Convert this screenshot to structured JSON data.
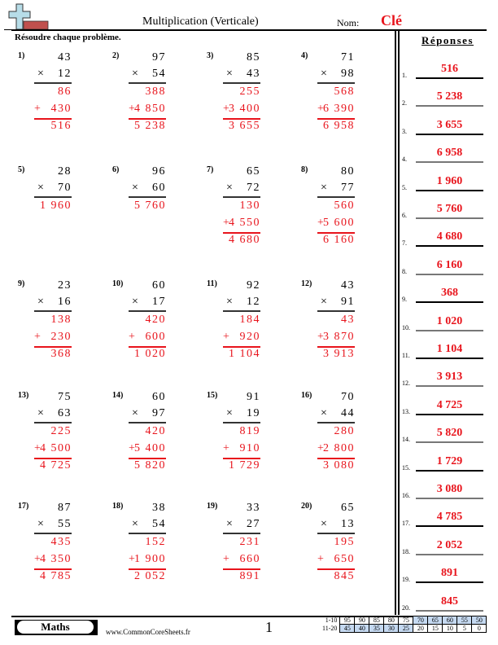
{
  "header": {
    "title": "Multiplication (Verticale)",
    "nom_label": "Nom:",
    "nom_value": "Clé",
    "instructions": "Résoudre chaque problème.",
    "logo_icon": "plus-sign-logo-icon"
  },
  "problems": [
    {
      "num": "1)",
      "a": "43",
      "b": "12",
      "p1": "86",
      "p2": "430",
      "total": "516"
    },
    {
      "num": "2)",
      "a": "97",
      "b": "54",
      "p1": "388",
      "p2": "4 850",
      "total": "5 238"
    },
    {
      "num": "3)",
      "a": "85",
      "b": "43",
      "p1": "255",
      "p2": "3 400",
      "total": "3 655"
    },
    {
      "num": "4)",
      "a": "71",
      "b": "98",
      "p1": "568",
      "p2": "6 390",
      "total": "6 958"
    },
    {
      "num": "5)",
      "a": "28",
      "b": "70",
      "total": "1 960"
    },
    {
      "num": "6)",
      "a": "96",
      "b": "60",
      "total": "5 760"
    },
    {
      "num": "7)",
      "a": "65",
      "b": "72",
      "p1": "130",
      "p2": "4 550",
      "total": "4 680"
    },
    {
      "num": "8)",
      "a": "80",
      "b": "77",
      "p1": "560",
      "p2": "5 600",
      "total": "6 160"
    },
    {
      "num": "9)",
      "a": "23",
      "b": "16",
      "p1": "138",
      "p2": "230",
      "total": "368"
    },
    {
      "num": "10)",
      "a": "60",
      "b": "17",
      "p1": "420",
      "p2": "600",
      "total": "1 020"
    },
    {
      "num": "11)",
      "a": "92",
      "b": "12",
      "p1": "184",
      "p2": "920",
      "total": "1 104"
    },
    {
      "num": "12)",
      "a": "43",
      "b": "91",
      "p1": "43",
      "p2": "3 870",
      "total": "3 913"
    },
    {
      "num": "13)",
      "a": "75",
      "b": "63",
      "p1": "225",
      "p2": "4 500",
      "total": "4 725"
    },
    {
      "num": "14)",
      "a": "60",
      "b": "97",
      "p1": "420",
      "p2": "5 400",
      "total": "5 820"
    },
    {
      "num": "15)",
      "a": "91",
      "b": "19",
      "p1": "819",
      "p2": "910",
      "total": "1 729"
    },
    {
      "num": "16)",
      "a": "70",
      "b": "44",
      "p1": "280",
      "p2": "2 800",
      "total": "3 080"
    },
    {
      "num": "17)",
      "a": "87",
      "b": "55",
      "p1": "435",
      "p2": "4 350",
      "total": "4 785"
    },
    {
      "num": "18)",
      "a": "38",
      "b": "54",
      "p1": "152",
      "p2": "1 900",
      "total": "2 052"
    },
    {
      "num": "19)",
      "a": "33",
      "b": "27",
      "p1": "231",
      "p2": "660",
      "total": "891"
    },
    {
      "num": "20)",
      "a": "65",
      "b": "13",
      "p1": "195",
      "p2": "650",
      "total": "845"
    }
  ],
  "symbols": {
    "times": "×",
    "plus": "+"
  },
  "answers": {
    "title": "Réponses",
    "items": [
      {
        "label": "1.",
        "value": "516"
      },
      {
        "label": "2.",
        "value": "5 238"
      },
      {
        "label": "3.",
        "value": "3 655"
      },
      {
        "label": "4.",
        "value": "6 958"
      },
      {
        "label": "5.",
        "value": "1 960"
      },
      {
        "label": "6.",
        "value": "5 760"
      },
      {
        "label": "7.",
        "value": "4 680"
      },
      {
        "label": "8.",
        "value": "6 160"
      },
      {
        "label": "9.",
        "value": "368"
      },
      {
        "label": "10.",
        "value": "1 020"
      },
      {
        "label": "11.",
        "value": "1 104"
      },
      {
        "label": "12.",
        "value": "3 913"
      },
      {
        "label": "13.",
        "value": "4 725"
      },
      {
        "label": "14.",
        "value": "5 820"
      },
      {
        "label": "15.",
        "value": "1 729"
      },
      {
        "label": "16.",
        "value": "3 080"
      },
      {
        "label": "17.",
        "value": "4 785"
      },
      {
        "label": "18.",
        "value": "2 052"
      },
      {
        "label": "19.",
        "value": "891"
      },
      {
        "label": "20.",
        "value": "845"
      }
    ]
  },
  "footer": {
    "subject": "Maths",
    "website": "www.CommonCoreSheets.fr",
    "page": "1",
    "score_table": {
      "rows": [
        {
          "label": "1-10",
          "scores": [
            "95",
            "90",
            "85",
            "80",
            "75",
            "70",
            "65",
            "60",
            "55",
            "50"
          ],
          "highlight": [
            false,
            false,
            false,
            false,
            false,
            true,
            true,
            true,
            true,
            true
          ]
        },
        {
          "label": "11-20",
          "scores": [
            "45",
            "40",
            "35",
            "30",
            "25",
            "20",
            "15",
            "10",
            "5",
            "0"
          ],
          "highlight": [
            true,
            true,
            true,
            true,
            true,
            false,
            false,
            false,
            false,
            false
          ]
        }
      ]
    }
  },
  "colors": {
    "answer_red": "#e8141c",
    "score_highlight": "#c5d9f1"
  }
}
